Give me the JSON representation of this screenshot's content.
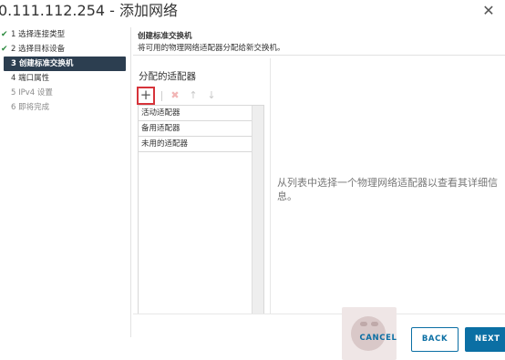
{
  "window": {
    "title": "0.111.112.254 - 添加网络",
    "close_glyph": "✕"
  },
  "steps": [
    {
      "label": "1 选择连接类型",
      "state": "done",
      "check": "✔"
    },
    {
      "label": "2 选择目标设备",
      "state": "done",
      "check": "✔"
    },
    {
      "label": "3 创建标准交换机",
      "state": "active"
    },
    {
      "label": "4 端口属性",
      "state": "pending"
    },
    {
      "label": "5 IPv4 设置",
      "state": "disabled"
    },
    {
      "label": "6 即将完成",
      "state": "disabled"
    }
  ],
  "header": {
    "title": "创建标准交换机",
    "subtitle": "将可用的物理网络适配器分配给新交换机。"
  },
  "adapters": {
    "section_label": "分配的适配器",
    "toolbar": {
      "add": "+",
      "remove": "✖",
      "up": "↑",
      "down": "↓"
    },
    "groups": [
      "活动适配器",
      "备用适配器",
      "未用的适配器"
    ]
  },
  "detail": {
    "message": "从列表中选择一个物理网络适配器以查看其详细信息。"
  },
  "buttons": {
    "cancel": "CANCEL",
    "back": "BACK",
    "next": "NEXT"
  }
}
